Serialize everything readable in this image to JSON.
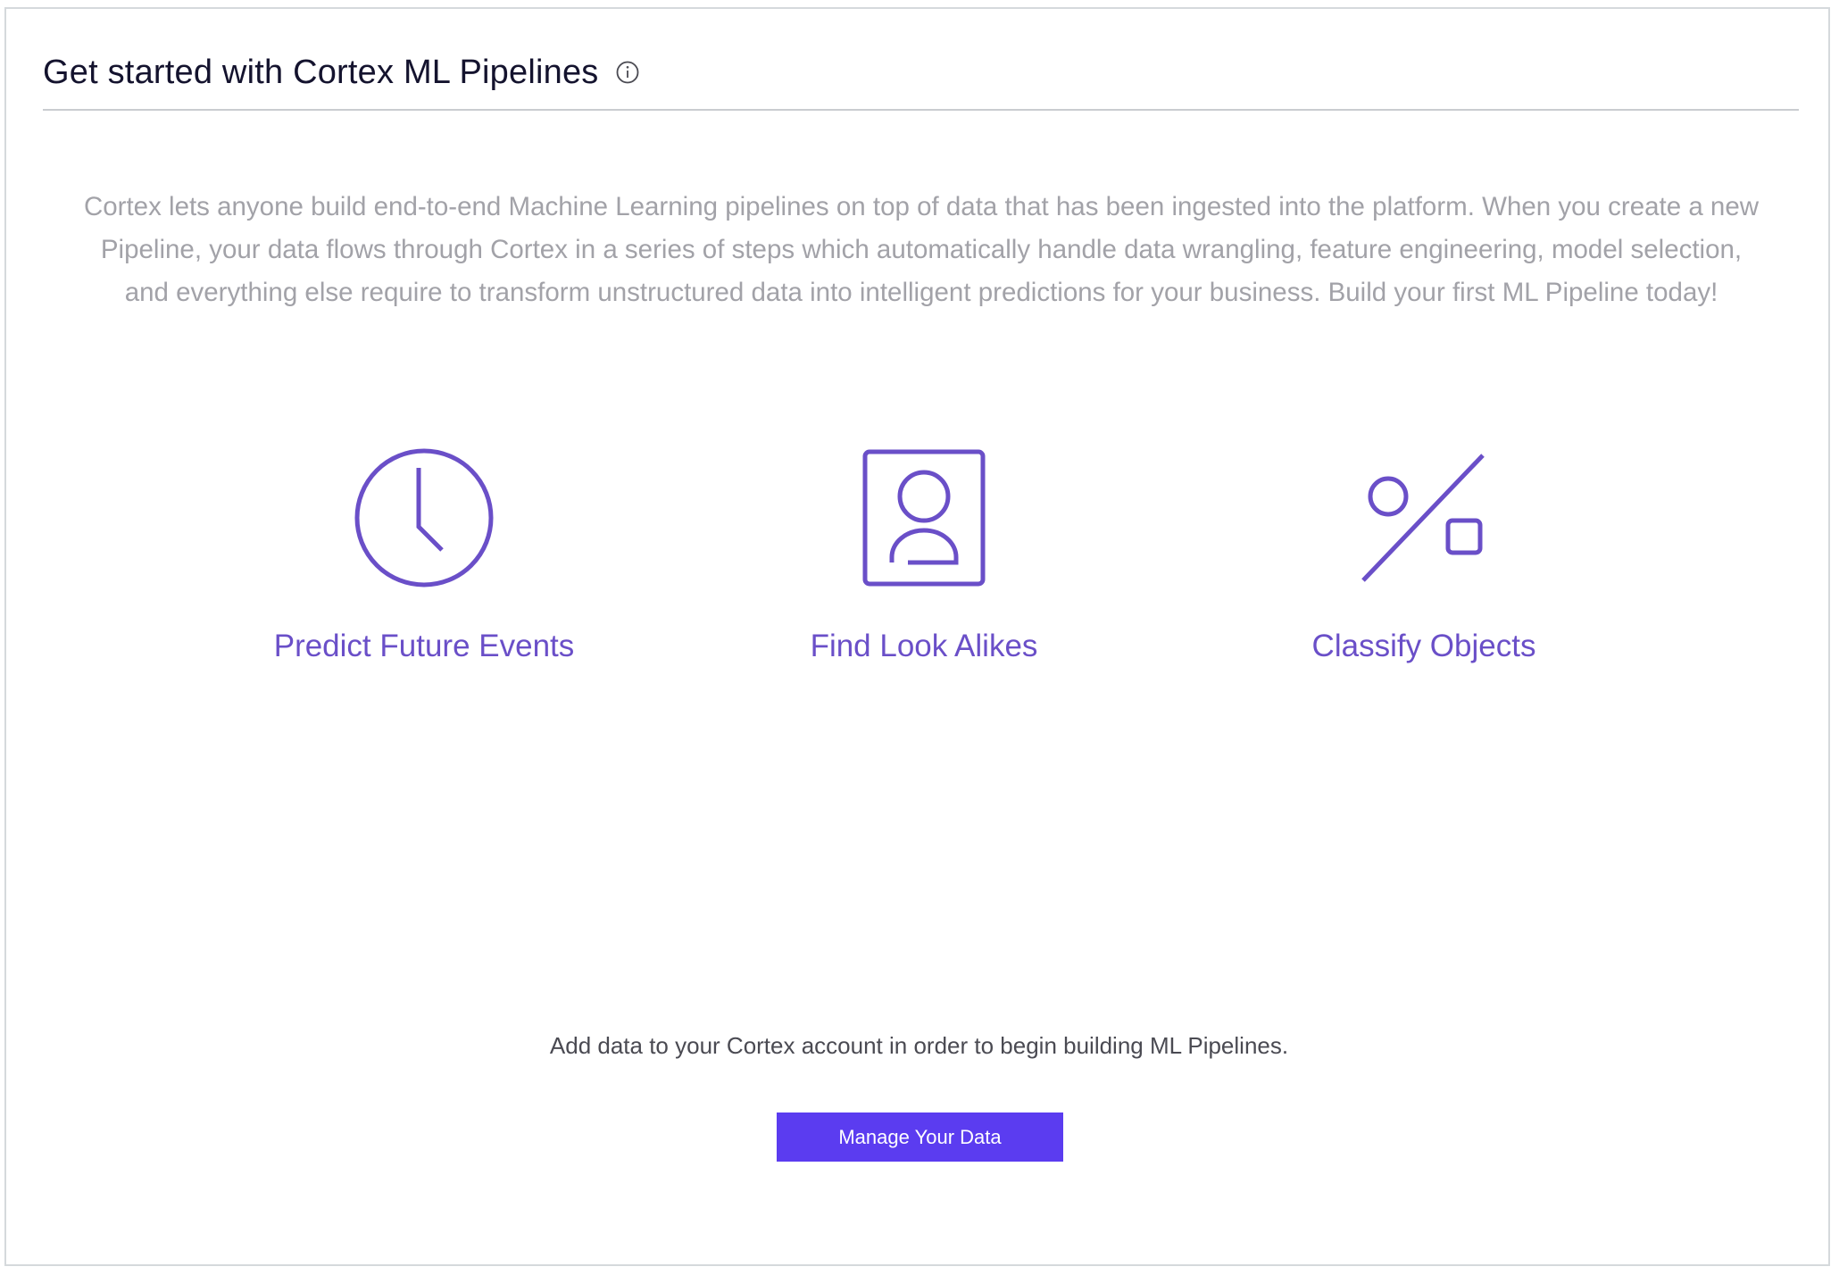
{
  "header": {
    "title": "Get started with Cortex ML Pipelines",
    "info_icon": "info-circle-icon"
  },
  "intro": {
    "text": "Cortex lets anyone build end-to-end Machine Learning pipelines on top of data that has been ingested into the platform. When you create a new Pipeline, your data flows through Cortex in a series of steps which automatically handle data wrangling, feature engineering, model selection, and everything else require to transform unstructured data into intelligent predictions for your business. Build your first ML Pipeline today!"
  },
  "use_cases": [
    {
      "label": "Predict Future Events",
      "icon": "clock-icon"
    },
    {
      "label": "Find Look Alikes",
      "icon": "person-portrait-icon"
    },
    {
      "label": "Classify Objects",
      "icon": "percent-shapes-icon"
    }
  ],
  "empty_state": {
    "message": "Add data to your Cortex account in order to begin building ML Pipelines.",
    "button_label": "Manage Your Data"
  },
  "colors": {
    "accent": "#6a4fc8",
    "button": "#5b3cf0",
    "title": "#14132e",
    "muted_text": "#a2a2a8",
    "divider": "#c9ccd0"
  }
}
